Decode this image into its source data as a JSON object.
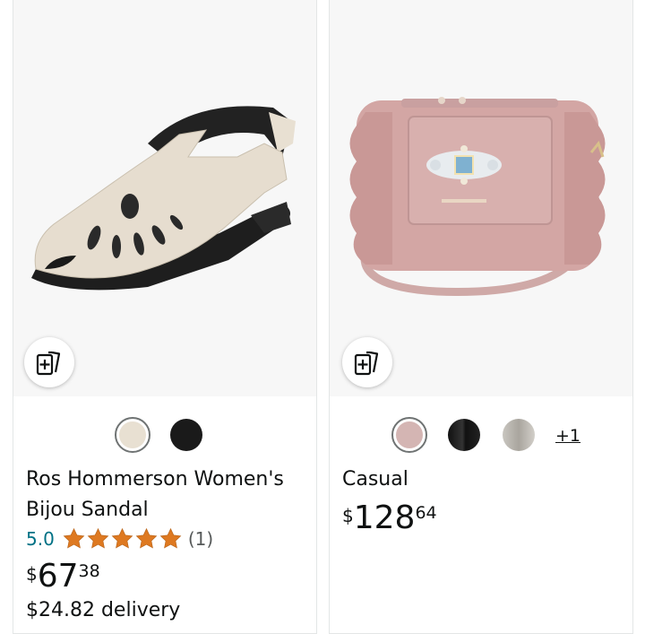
{
  "products": [
    {
      "image_alt": "Ros Hommerson Women's Bijou Sandal",
      "compare_icon": "compare-cards-icon",
      "swatches": [
        {
          "color": "#e8e0d2",
          "selected": true
        },
        {
          "color": "#1a1a1a",
          "selected": false
        }
      ],
      "title": "Ros Hommerson Women's Bijou Sandal",
      "rating_value": "5.0",
      "rating_count": "(1)",
      "stars": 5,
      "price_symbol": "$",
      "price_whole": "67",
      "price_fraction": "38",
      "delivery": "$24.82 delivery"
    },
    {
      "image_alt": "Casual",
      "compare_icon": "compare-cards-icon",
      "swatches": [
        {
          "color": "#d4b5b3",
          "selected": true
        },
        {
          "color": "#111111",
          "selected": false
        },
        {
          "color": "#b9b6b0",
          "selected": false
        }
      ],
      "more_label": "+1",
      "title": "Casual",
      "price_symbol": "$",
      "price_whole": "128",
      "price_fraction": "64"
    }
  ],
  "colors": {
    "star": "#de7921",
    "link": "#007185",
    "image_bg": "#f7f7f7"
  }
}
